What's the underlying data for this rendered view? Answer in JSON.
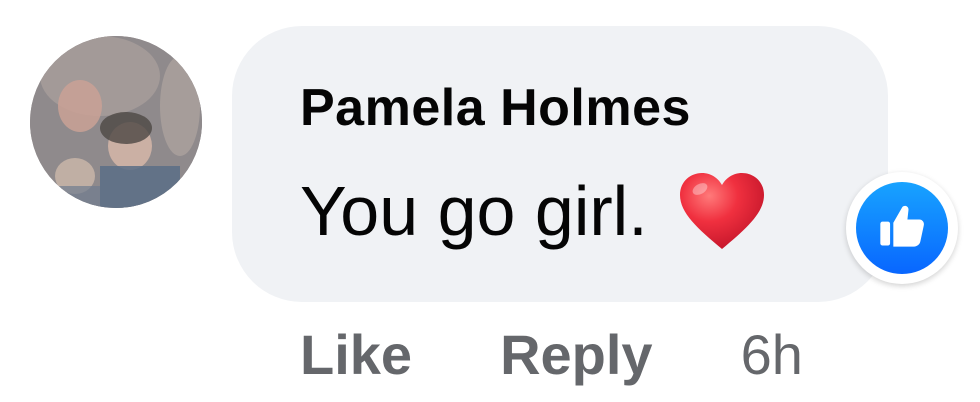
{
  "comment": {
    "author": "Pamela Holmes",
    "text": "You go girl.",
    "emoji_icon": "heart-icon",
    "reaction_icon": "thumbs-up-icon",
    "actions": {
      "like_label": "Like",
      "reply_label": "Reply"
    },
    "timestamp": "6h"
  },
  "colors": {
    "bubble": "#f0f2f5",
    "text": "#050505",
    "secondary_text": "#65676b",
    "reaction_blue": "#0866ff",
    "heart_red": "#e0243a"
  }
}
